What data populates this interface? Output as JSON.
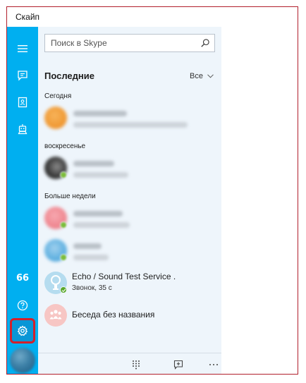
{
  "window": {
    "title": "Скайп"
  },
  "rail": {
    "items": [
      {
        "icon": "hamburger-menu-icon"
      },
      {
        "icon": "chat-icon"
      },
      {
        "icon": "contacts-icon"
      },
      {
        "icon": "bot-icon"
      }
    ],
    "quote_label": "66",
    "help_icon": "help-icon",
    "settings_icon": "settings-gear-icon",
    "accent_color": "#00aff0",
    "highlight_color": "#d4202b"
  },
  "search": {
    "placeholder": "Поиск в Skype"
  },
  "recent": {
    "title": "Последние",
    "filter": "Все",
    "groups": [
      {
        "label": "Сегодня"
      },
      {
        "label": "воскресенье"
      },
      {
        "label": "Больше недели"
      }
    ]
  },
  "contacts": [
    {
      "name": "Echo / Sound Test Service .",
      "subtitle": "Звонок, 35 с"
    },
    {
      "name": "Беседа без названия"
    }
  ],
  "bottombar": {
    "items": [
      {
        "icon": "dialpad-icon"
      },
      {
        "icon": "new-chat-icon"
      },
      {
        "icon": "more-icon"
      }
    ]
  }
}
